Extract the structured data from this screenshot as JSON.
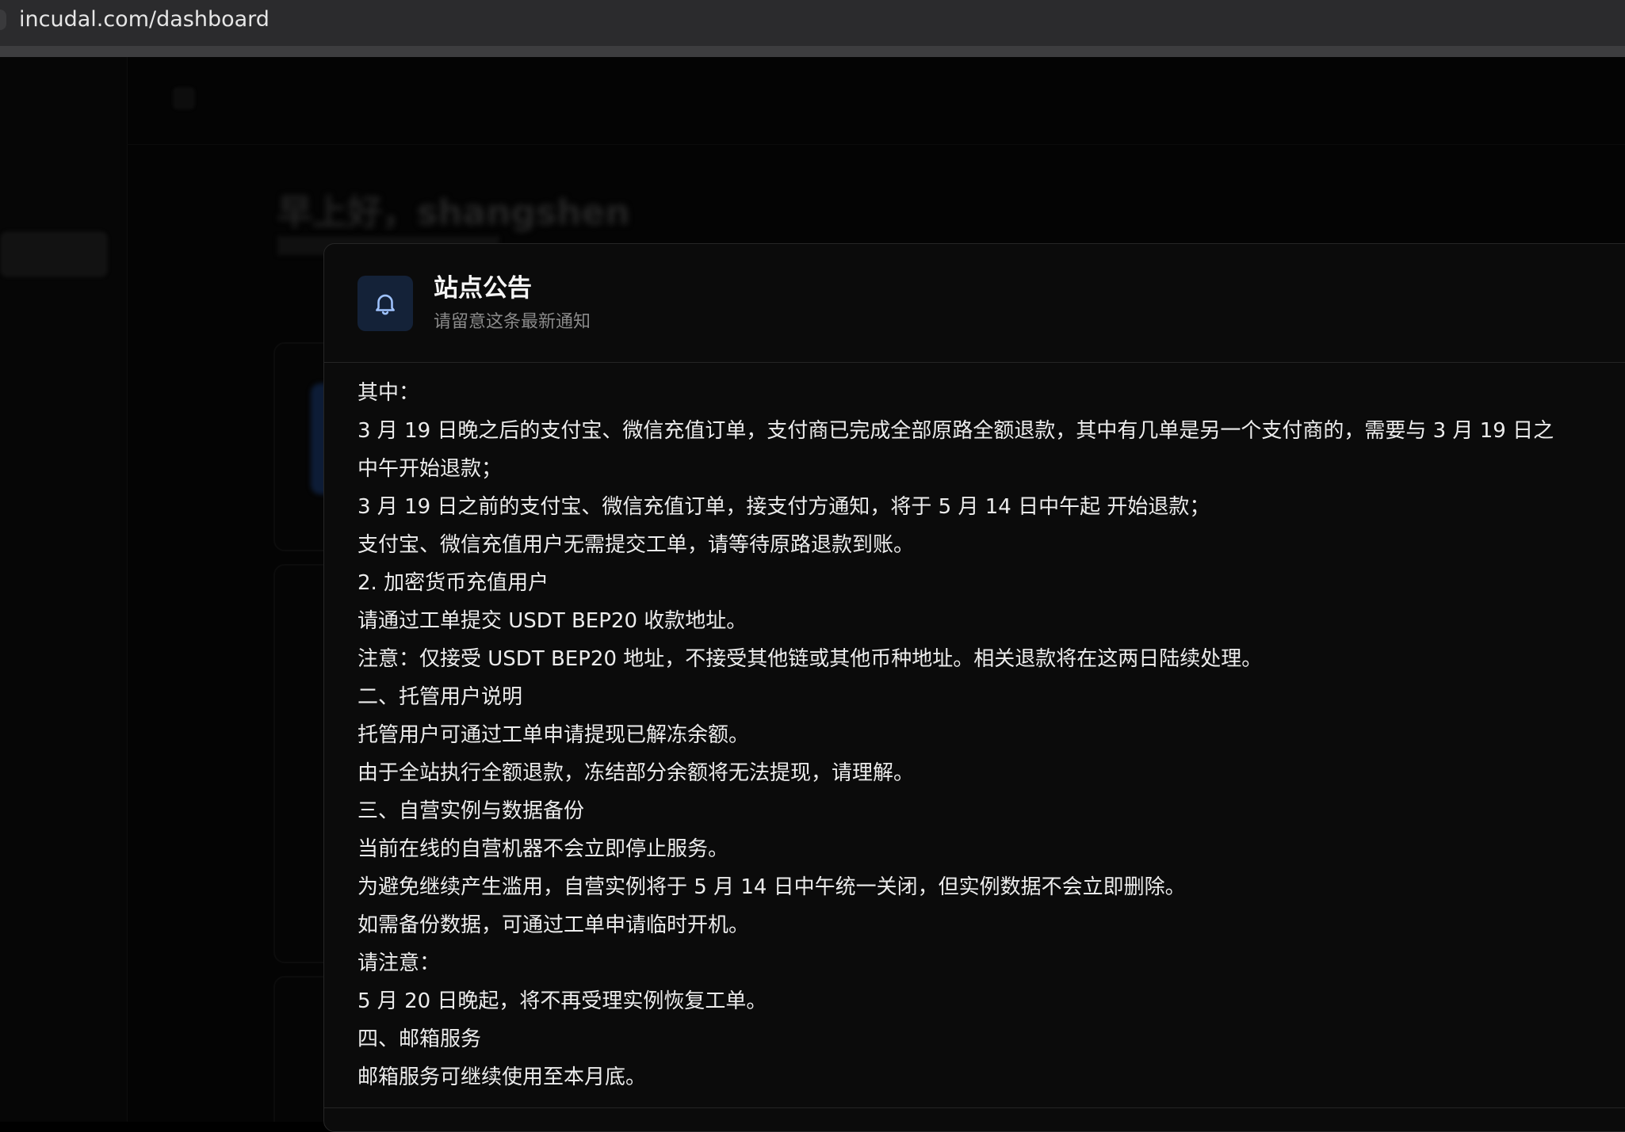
{
  "browser": {
    "url": "incudal.com/dashboard"
  },
  "background": {
    "greeting": "早上好，shangshen"
  },
  "announcement": {
    "icon": "bell-icon",
    "title": "站点公告",
    "subtitle": "请留意这条最新通知",
    "lines": [
      "其中：",
      "3 月 19 日晚之后的支付宝、微信充值订单，支付商已完成全部原路全额退款，其中有几单是另一个支付商的，需要与 3 月 19 日之",
      "中午开始退款；",
      "3 月 19 日之前的支付宝、微信充值订单，接支付方通知，将于 5 月 14 日中午起 开始退款；",
      "支付宝、微信充值用户无需提交工单，请等待原路退款到账。",
      "2. 加密货币充值用户",
      "请通过工单提交 USDT BEP20 收款地址。",
      "注意：仅接受 USDT BEP20 地址，不接受其他链或其他币种地址。相关退款将在这两日陆续处理。",
      "二、托管用户说明",
      "托管用户可通过工单申请提现已解冻余额。",
      "由于全站执行全额退款，冻结部分余额将无法提现，请理解。",
      "三、自营实例与数据备份",
      "当前在线的自营机器不会立即停止服务。",
      "为避免继续产生滥用，自营实例将于 5 月 14 日中午统一关闭，但实例数据不会立即删除。",
      "如需备份数据，可通过工单申请临时开机。",
      "请注意：",
      "5 月 20 日晚起，将不再受理实例恢复工单。",
      "四、邮箱服务",
      "邮箱服务可继续使用至本月底。"
    ]
  },
  "colors": {
    "page_bg": "#040404",
    "modal_bg": "#0b0b0b",
    "icon_box_bg": "#142238",
    "icon_stroke": "#9fc3ff",
    "text_primary": "#ececec",
    "text_secondary": "#8a8a8a"
  }
}
